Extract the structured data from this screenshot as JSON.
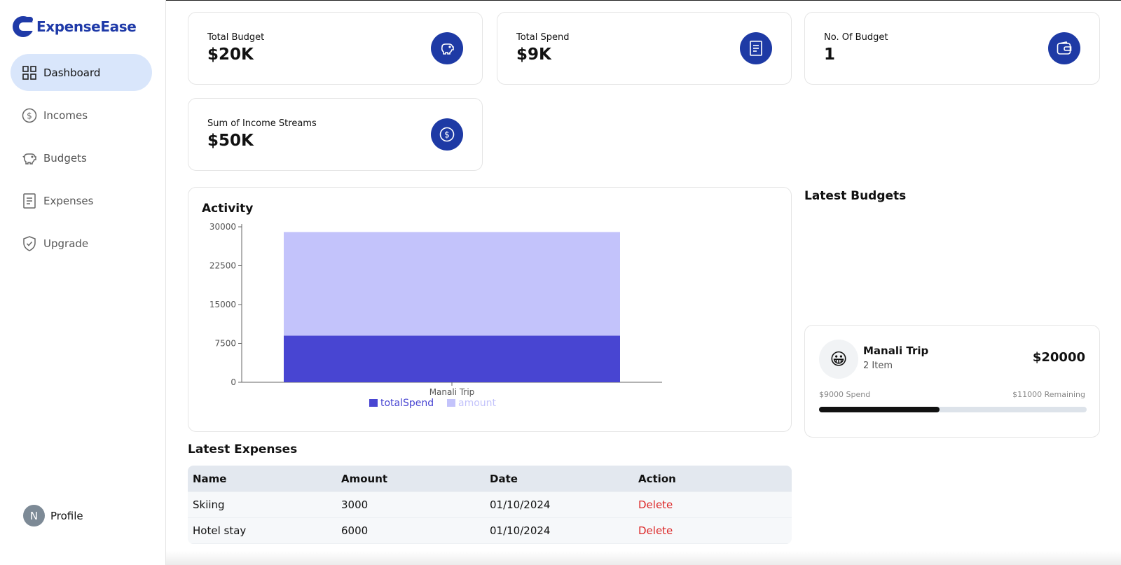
{
  "app": {
    "name": "ExpenseEase"
  },
  "colors": {
    "brand": "#1f3aa8",
    "icon_bg": "#1e3aa5",
    "active_nav": "#d9e6fb",
    "total_spend": "#4845d2",
    "amount": "#c3c3fb",
    "delete": "#dc2626"
  },
  "sidebar": {
    "items": [
      {
        "label": "Dashboard",
        "icon": "dashboard-grid-icon",
        "active": true
      },
      {
        "label": "Incomes",
        "icon": "dollar-circle-icon",
        "active": false
      },
      {
        "label": "Budgets",
        "icon": "piggy-bank-icon",
        "active": false
      },
      {
        "label": "Expenses",
        "icon": "receipt-icon",
        "active": false
      },
      {
        "label": "Upgrade",
        "icon": "shield-check-icon",
        "active": false
      }
    ],
    "profile": {
      "initial": "N",
      "label": "Profile"
    }
  },
  "stats": [
    {
      "label": "Total Budget",
      "value": "$20K",
      "icon": "piggy-bank-icon"
    },
    {
      "label": "Total Spend",
      "value": "$9K",
      "icon": "receipt-icon"
    },
    {
      "label": "No. Of Budget",
      "value": "1",
      "icon": "wallet-icon"
    },
    {
      "label": "Sum of Income Streams",
      "value": "$50K",
      "icon": "dollar-circle-icon"
    }
  ],
  "chart_data": {
    "type": "bar",
    "title": "Activity",
    "stacked": true,
    "categories": [
      "Manali Trip"
    ],
    "series": [
      {
        "name": "totalSpend",
        "values": [
          9000
        ],
        "color": "#4845d2"
      },
      {
        "name": "amount",
        "values": [
          20000
        ],
        "color": "#c3c3fb"
      }
    ],
    "yticks": [
      "0",
      "7500",
      "15000",
      "22500",
      "30000"
    ],
    "ylim": [
      0,
      30000
    ],
    "legend": "bottom-center",
    "grid": false
  },
  "latest_expenses": {
    "title": "Latest Expenses",
    "columns": [
      "Name",
      "Amount",
      "Date",
      "Action"
    ],
    "rows": [
      {
        "name": "Skiing",
        "amount": "3000",
        "date": "01/10/2024",
        "action": "Delete"
      },
      {
        "name": "Hotel stay",
        "amount": "6000",
        "date": "01/10/2024",
        "action": "Delete"
      }
    ]
  },
  "latest_budgets": {
    "title": "Latest Budgets",
    "items": [
      {
        "emoji": "😀",
        "name": "Manali Trip",
        "items": "2 Item",
        "amount": "$20000",
        "spend": "$9000 Spend",
        "remaining": "$11000 Remaining",
        "progress_fraction": 0.45
      }
    ]
  }
}
